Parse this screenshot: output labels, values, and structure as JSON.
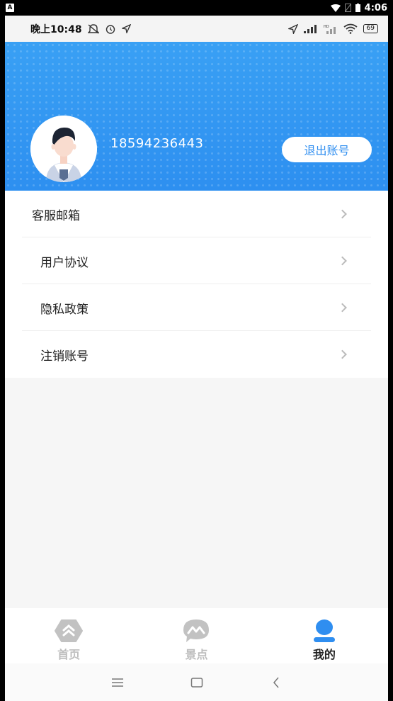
{
  "system_bar": {
    "badge": "A",
    "time": "4:06"
  },
  "status_bar": {
    "time": "晚上10:48",
    "battery": "69"
  },
  "profile": {
    "phone_number": "18594236443",
    "logout_label": "退出账号"
  },
  "menu": {
    "items": [
      {
        "label": "客服邮箱"
      },
      {
        "label": "用户协议"
      },
      {
        "label": "隐私政策"
      },
      {
        "label": "注销账号"
      }
    ]
  },
  "tabs": [
    {
      "label": "首页",
      "icon": "home-icon",
      "active": false
    },
    {
      "label": "景点",
      "icon": "scenic-icon",
      "active": false
    },
    {
      "label": "我的",
      "icon": "profile-icon",
      "active": true
    }
  ],
  "colors": {
    "accent": "#2f8ef0",
    "inactive": "#bdbdbd",
    "active_text": "#222222"
  }
}
